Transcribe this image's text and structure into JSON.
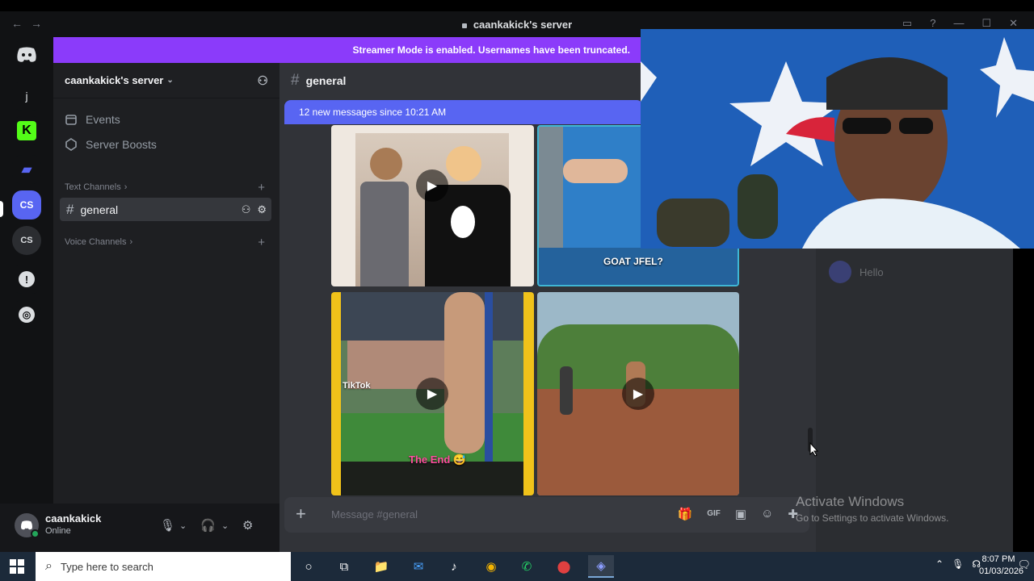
{
  "window": {
    "title": "caankakick's server",
    "nav_back": "←",
    "nav_fwd": "→",
    "controls": [
      "▭",
      "?",
      "—",
      "☐",
      "✕"
    ]
  },
  "banner": {
    "text": "Streamer Mode is enabled. Usernames have been truncated."
  },
  "rail": {
    "home_glyph": "◉",
    "items": [
      {
        "label": "j"
      },
      {
        "label": "K"
      },
      {
        "label": "▰"
      },
      {
        "label": "CS"
      },
      {
        "label": "CS"
      },
      {
        "label": "!"
      },
      {
        "label": "◎"
      }
    ]
  },
  "sidebar": {
    "server_name": "caankakick's server",
    "chevron": "⌄",
    "invite_glyph": "⚇",
    "events_label": "Events",
    "boosts_label": "Server Boosts",
    "text_category": "Text Channels",
    "voice_category": "Voice Channels",
    "cat_arrow": "›",
    "plus": "+",
    "active_channel": "general",
    "hash": "#",
    "channel_tools": [
      "⚇",
      "⚙"
    ]
  },
  "user": {
    "name": "caankakick",
    "status": "Online",
    "mic": "🎙",
    "headset": "🎧",
    "settings": "⚙",
    "dropdown": "⌄"
  },
  "chat": {
    "channel": "general",
    "hash": "#",
    "new_messages": "12 new messages since 10:21 AM",
    "play": "▶",
    "tiles": [
      {
        "label": ""
      },
      {
        "label": "GOAT JFEL?"
      },
      {
        "label": "TikTok"
      },
      {
        "label": ""
      }
    ],
    "end_label": "The End 😅",
    "composer_plus": "+",
    "composer_placeholder": "Message #general",
    "composer_tools": [
      "🎁",
      "GIF",
      "▣",
      "☺",
      "✚"
    ]
  },
  "members": {
    "name": "Hello"
  },
  "watermark": {
    "line1": "Activate Windows",
    "line2": "Go to Settings to activate Windows."
  },
  "taskbar": {
    "search_placeholder": "Type here to search",
    "search_glyph": "⌕",
    "icons": [
      "○",
      "⧉",
      "📁",
      "✉",
      "♪",
      "◉",
      "✆",
      "⬤",
      "◈"
    ],
    "tray": [
      "⌃",
      "🎙",
      "☊"
    ],
    "time": "8:07 PM",
    "date": "01/03/2026",
    "notify_glyph": "🗨"
  },
  "colors": {
    "blurple": "#5865f2",
    "streamer_purple": "#8b3bfa",
    "online": "#23a55a"
  }
}
